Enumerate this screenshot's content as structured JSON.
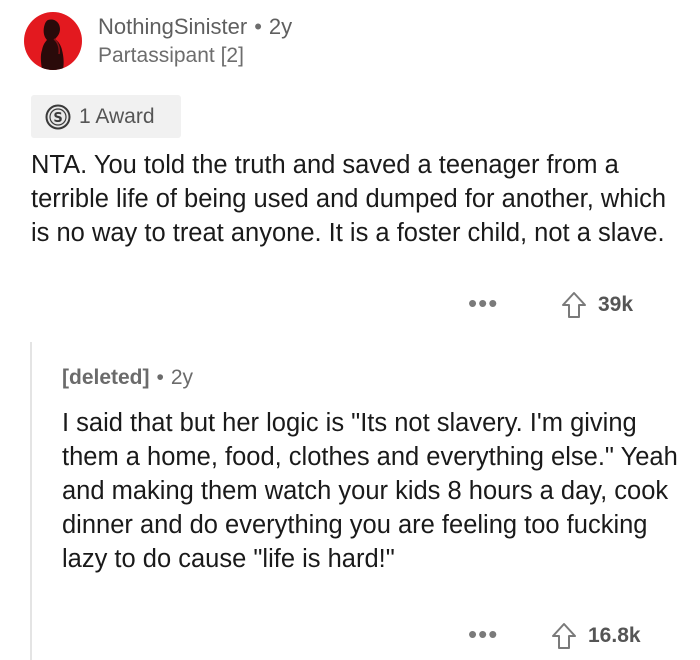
{
  "comment": {
    "username": "NothingSinister",
    "separator": "•",
    "age": "2y",
    "flair": "Partassipant [2]",
    "award_label": "1 Award",
    "text": "NTA. You told the truth and saved a teenager from a terrible life of being used and dumped for another, which is no way to treat anyone. It is a foster child, not a slave.",
    "more_label": "•••",
    "score": "39k"
  },
  "reply": {
    "username": "[deleted]",
    "separator": "•",
    "age": "2y",
    "text": "I said that but her logic is \"Its not slavery. I'm giving them a home, food, clothes and everything else.\" Yeah and making them watch your kids 8 hours a day, cook dinner and do everything you are feeling too fucking lazy to do cause \"life is hard!\"",
    "more_label": "•••",
    "score": "16.8k"
  },
  "colors": {
    "avatar_bg": "#e3191f",
    "text_primary": "#1a1a1a",
    "text_muted": "#6b6b6b",
    "award_bg": "#f1f1f1"
  },
  "icons": {
    "avatar": "silhouette-avatar-icon",
    "award": "silver-award-coin-icon",
    "upvote": "upvote-arrow-icon",
    "more": "more-options-icon"
  }
}
